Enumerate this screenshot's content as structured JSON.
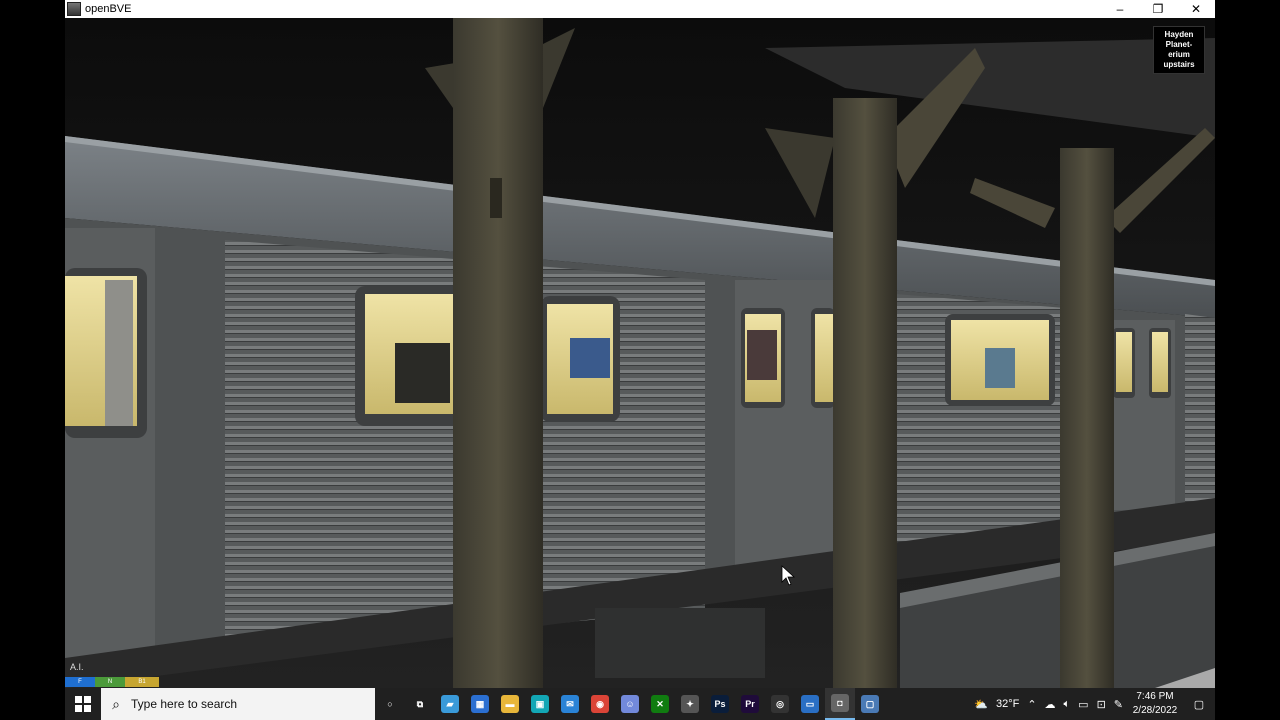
{
  "window": {
    "title": "openBVE",
    "controls": {
      "minimize": "–",
      "maximize": "❐",
      "close": "✕"
    }
  },
  "hud": {
    "sign_lines": [
      "Hayden",
      "Planet-",
      "erium",
      "upstairs"
    ],
    "bottom_left_label": "A.I.",
    "indicator_segments": [
      {
        "label": "F",
        "color": "#1f6fd1"
      },
      {
        "label": "N",
        "color": "#4b9a3a"
      },
      {
        "label": "B1",
        "color": "#c7a631"
      }
    ]
  },
  "taskbar": {
    "search_placeholder": "Type here to search",
    "apps": [
      {
        "name": "cortana-icon",
        "glyph": "○",
        "color": "#202020"
      },
      {
        "name": "task-view-icon",
        "glyph": "⧉",
        "color": "#202020"
      },
      {
        "name": "notebook-app-icon",
        "glyph": "▰",
        "color": "#3a9ad9"
      },
      {
        "name": "store-icon",
        "glyph": "▦",
        "color": "#2b6fd1"
      },
      {
        "name": "file-explorer-icon",
        "glyph": "▬",
        "color": "#e8b63a"
      },
      {
        "name": "media-app-icon",
        "glyph": "▣",
        "color": "#13a7b5"
      },
      {
        "name": "mail-icon",
        "glyph": "✉",
        "color": "#2a83d6"
      },
      {
        "name": "chrome-icon",
        "glyph": "◉",
        "color": "#db4437"
      },
      {
        "name": "discord-icon",
        "glyph": "☺",
        "color": "#7289da"
      },
      {
        "name": "xbox-icon",
        "glyph": "✕",
        "color": "#107c10"
      },
      {
        "name": "tools-app-icon",
        "glyph": "✦",
        "color": "#555555"
      },
      {
        "name": "photoshop-icon",
        "glyph": "Ps",
        "color": "#0a1d3a"
      },
      {
        "name": "premiere-icon",
        "glyph": "Pr",
        "color": "#1f0b3a"
      },
      {
        "name": "obs-icon",
        "glyph": "◎",
        "color": "#333333"
      },
      {
        "name": "screen-capture-icon",
        "glyph": "▭",
        "color": "#2a6fc4"
      },
      {
        "name": "openbve-icon",
        "glyph": "◘",
        "color": "#666666",
        "active": true
      },
      {
        "name": "window-app-icon",
        "glyph": "▢",
        "color": "#4a7ab5"
      }
    ],
    "weather": "32°F",
    "time": "7:46 PM",
    "date": "2/28/2022"
  }
}
